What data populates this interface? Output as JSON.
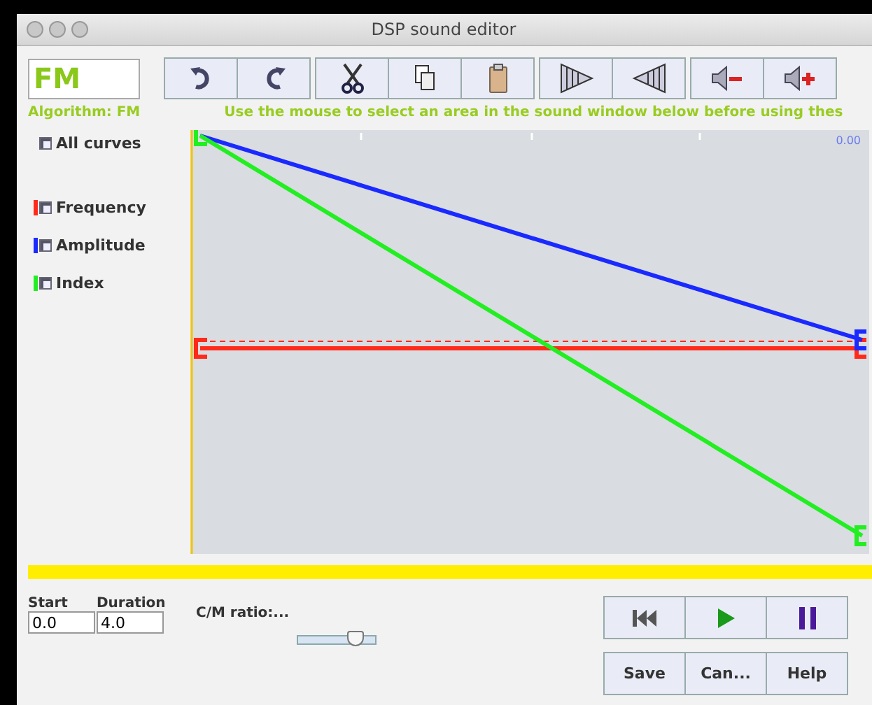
{
  "window": {
    "title": "DSP sound editor"
  },
  "algorithm_field": {
    "value": "FM"
  },
  "algorithm_label": "Algorithm: FM",
  "toolbar": [
    {
      "kind": "undo"
    },
    {
      "kind": "redo"
    },
    {
      "kind": "cut"
    },
    {
      "kind": "copy"
    },
    {
      "kind": "paste"
    },
    {
      "kind": "fade-in"
    },
    {
      "kind": "fade-out"
    },
    {
      "kind": "volume-down"
    },
    {
      "kind": "volume-up"
    }
  ],
  "hint": "Use the mouse to select an area in the sound window below before using thes",
  "all_curves": {
    "label": "All curves",
    "checked": true
  },
  "curves": [
    {
      "name": "Frequency",
      "color": "#ff2a1a",
      "checked": true
    },
    {
      "name": "Amplitude",
      "color": "#1a2aff",
      "checked": true
    },
    {
      "name": "Index",
      "color": "#22ee22",
      "checked": true
    }
  ],
  "canvas": {
    "position_label": "0.00"
  },
  "start": {
    "label": "Start",
    "value": "0.0"
  },
  "duration": {
    "label": "Duration",
    "value": "4.0"
  },
  "ratio": {
    "label": "C/M ratio:...",
    "level": 0.75
  },
  "transport": [
    {
      "kind": "rewind"
    },
    {
      "kind": "play"
    },
    {
      "kind": "pause"
    }
  ],
  "buttons": [
    "Save",
    "Can...",
    "Help"
  ]
}
